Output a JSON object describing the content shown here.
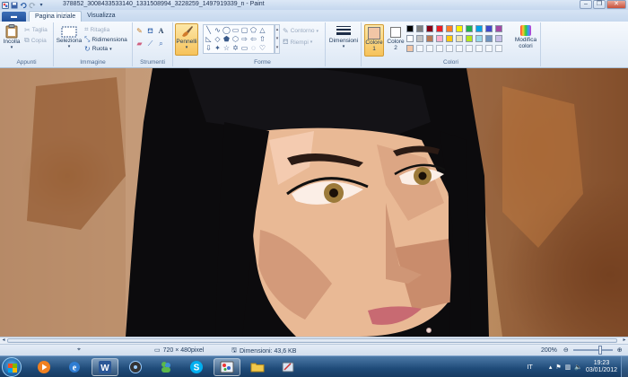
{
  "window": {
    "title": "378852_3008433533140_1331508994_3228259_1497919339_n - Paint",
    "minimize_glyph": "–",
    "maximize_glyph": "❐",
    "close_glyph": "✕"
  },
  "tabs": [
    {
      "label": "Pagina iniziale",
      "active": true
    },
    {
      "label": "Visualizza",
      "active": false
    }
  ],
  "app_menu_glyph": "▬",
  "groups": {
    "appunti": {
      "label": "Appunti",
      "incolla": "Incolla",
      "taglia": "Taglia",
      "copia": "Copia"
    },
    "immagine": {
      "label": "Immagine",
      "seleziona": "Seleziona",
      "ritaglia": "Ritaglia",
      "ridimensiona": "Ridimensiona",
      "ruota": "Ruota"
    },
    "strumenti": {
      "label": "Strumenti"
    },
    "pennelli": {
      "label": "Pennelli"
    },
    "forme": {
      "label": "Forme",
      "contorno": "Contorno",
      "riempi": "Riempi"
    },
    "dimensioni": {
      "label": "Dimensioni"
    },
    "colori": {
      "label": "Colori",
      "colore1": "Colore 1",
      "colore2": "Colore 2",
      "modifica": "Modifica colori",
      "colore1_value": "#f2c6a6",
      "colore2_value": "#ffffff",
      "palette_row1": [
        "#000000",
        "#7f7f7f",
        "#880015",
        "#ed1c24",
        "#ff7f27",
        "#fff200",
        "#22b14c",
        "#00a2e8",
        "#3f48cc",
        "#a349a4"
      ],
      "palette_row2": [
        "#ffffff",
        "#c3c3c3",
        "#b97a57",
        "#ffaec9",
        "#ffc90e",
        "#efe4b0",
        "#b5e61d",
        "#99d9ea",
        "#7092be",
        "#c8bfe7"
      ],
      "palette_row3": [
        "#f2c6a6",
        "#ffffff",
        "#ffffff",
        "#ffffff",
        "#ffffff",
        "#ffffff",
        "#ffffff",
        "#ffffff",
        "#ffffff",
        "#ffffff"
      ]
    }
  },
  "status": {
    "image_size": "720 × 480pixel",
    "file_size": "Dimensioni: 43,6 KB",
    "zoom": "200%"
  },
  "taskbar": {
    "lang": "IT",
    "time": "19:23",
    "date": "03/01/2012"
  }
}
